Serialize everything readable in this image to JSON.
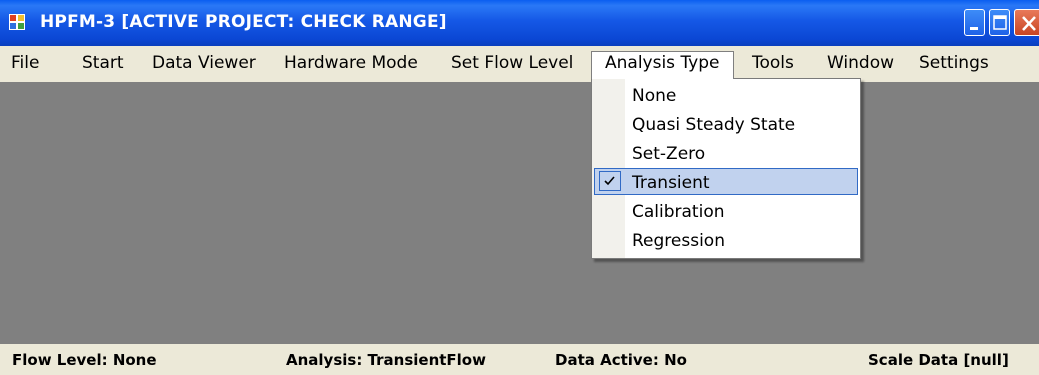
{
  "window": {
    "title": "HPFM-3  [ACTIVE PROJECT: CHECK RANGE]",
    "icons": [
      "app-icon",
      "minimize-icon",
      "maximize-icon",
      "close-icon"
    ]
  },
  "menu": {
    "items": [
      "File",
      "Start",
      "Data Viewer",
      "Hardware Mode",
      "Set Flow Level",
      "Analysis Type",
      "Tools",
      "Window",
      "Settings"
    ],
    "open_menu": "Analysis Type"
  },
  "analysis_menu": {
    "items": [
      "None",
      "Quasi Steady State",
      "Set-Zero",
      "Transient",
      "Calibration",
      "Regression"
    ],
    "checked": "Transient"
  },
  "status": {
    "flow_level": "Flow Level: None",
    "analysis": "Analysis: TransientFlow",
    "data_active": "Data Active: No",
    "scale_data": "Scale Data  [null]"
  },
  "colors": {
    "titlebar": "#0a46d4",
    "menubar": "#ece9d8",
    "client": "#808080",
    "selection": "#c1d2ee",
    "selection_border": "#316ac5"
  }
}
